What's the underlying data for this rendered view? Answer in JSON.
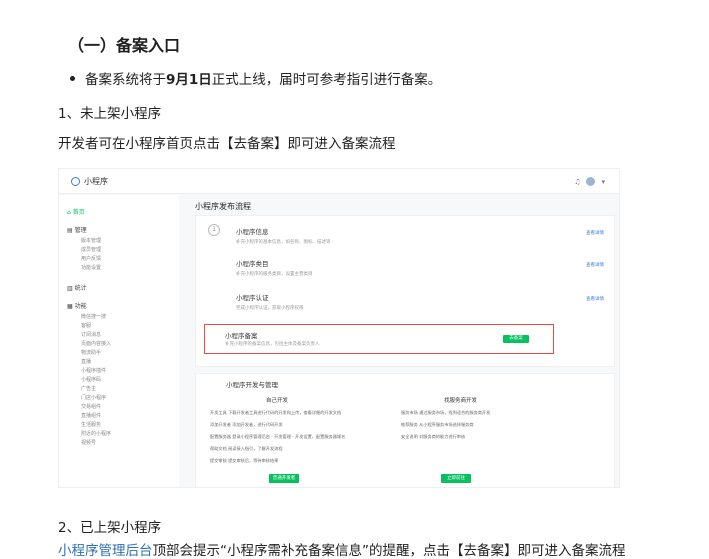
{
  "heading": "（一）备案入口",
  "bullet": {
    "pre": "备案系统将于",
    "bold": "9月1日",
    "post": "正式上线，届时可参考指引进行备案。"
  },
  "p1": "1、未上架小程序",
  "p2": "开发者可在小程序首页点击【去备案】即可进入备案流程",
  "p3": "2、已上架小程序",
  "p4": {
    "link": "小程序管理后台",
    "text": "顶部会提示“小程序需补充备案信息”的提醒，点击【去备案】即可进入备案流程"
  },
  "shot": {
    "logo": "小程序",
    "sidebar": {
      "home": "首页",
      "manage": "管理",
      "manage_items": [
        "版本管理",
        "成员管理",
        "用户反馈",
        "功能设置"
      ],
      "stats": "统计",
      "features": "功能",
      "feature_items": [
        "微信搜一搜",
        "客服",
        "订阅消息",
        "页面内容接入",
        "物流助手",
        "直播",
        "小程序插件",
        "小程序码",
        "广告主",
        "门店小程序",
        "交易组件",
        "直播组件",
        "生活服务",
        "附近的小程序",
        "视频号"
      ]
    },
    "main_title": "小程序发布流程",
    "steps": [
      {
        "title": "小程序信息",
        "desc": "补充小程序的基本信息，如名称、图标、描述等",
        "link": "查看详情"
      },
      {
        "title": "小程序类目",
        "desc": "补充小程序的服务类目，设置主营类目",
        "link": "查看详情"
      },
      {
        "title": "小程序认证",
        "desc": "完成小程序认证，获取小程序权限",
        "link": "查看详情"
      },
      {
        "title": "小程序备案",
        "desc": "补充小程序的备案信息，包括主体及备案负责人",
        "button": "去备案"
      }
    ],
    "section2": "小程序开发与管理",
    "dev_left_title": "自己开发",
    "dev_left_rows": [
      "开发工具  下载开发者工具进行代码的开发和上传，查看详细的开发文档",
      "添加开发者  添加开发者，进行代码开发",
      "配置服务器  登录小程序管理后台 - 开发管理 - 开发设置，配置服务器域名",
      "帮助文档  阅读接入指引，了解开发流程",
      "提交审核  提交审核后，等待审核结果"
    ],
    "dev_left_btn": "普通开发者",
    "dev_right_title": "找服务商开发",
    "dev_right_rows": [
      "服务市场  通过服务市场，找到适合的服务商开发",
      "推荐服务  从小程序服务市场选择服务商",
      "安全说明  对服务商的能力进行审核"
    ],
    "dev_right_btn": "立即前往"
  }
}
